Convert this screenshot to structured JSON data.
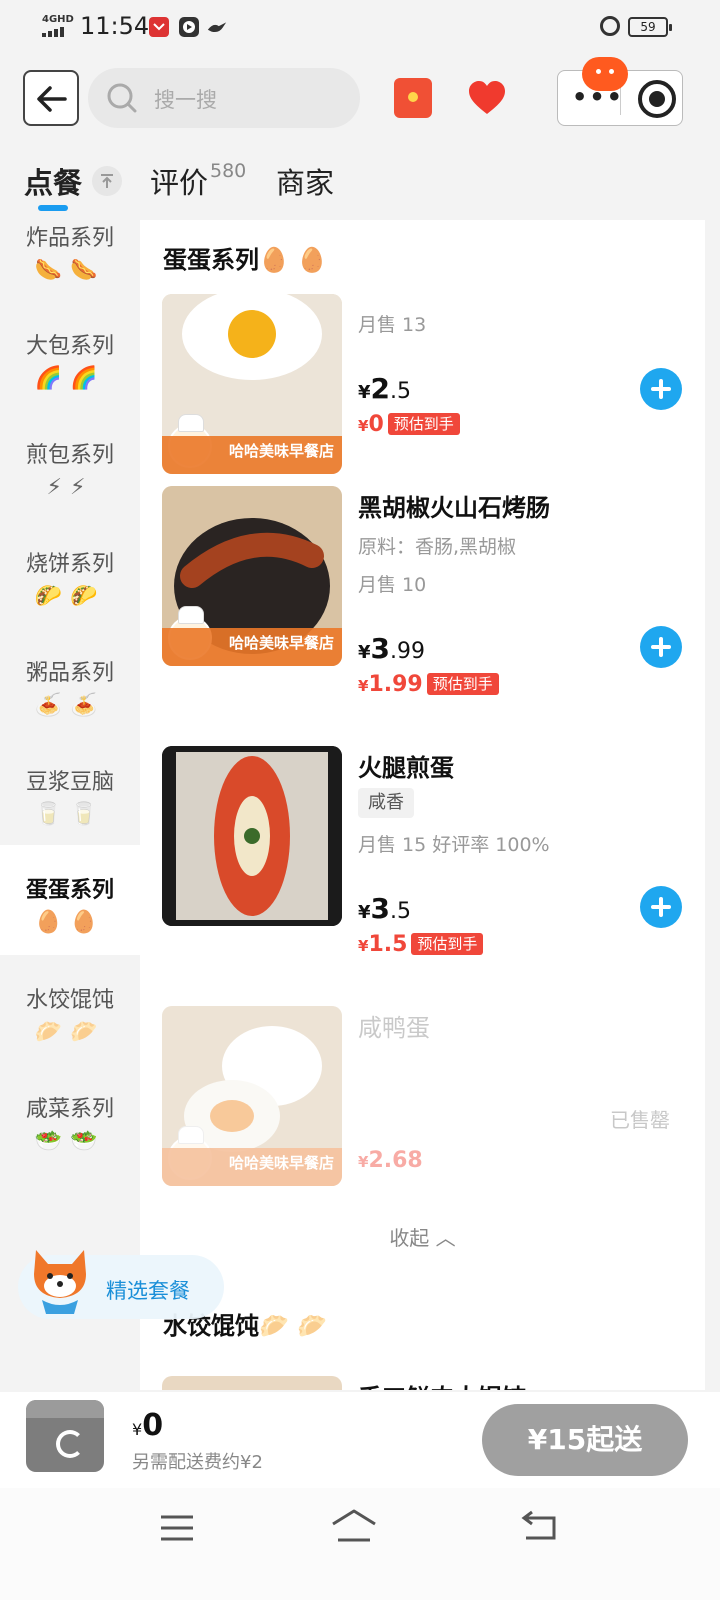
{
  "status_bar": {
    "network": "4GHD",
    "time": "11:54",
    "battery": "59"
  },
  "header": {
    "search_placeholder": "搜一搜"
  },
  "tabs": {
    "order": "点餐",
    "reviews": "评价",
    "reviews_count": "580",
    "shop": "商家"
  },
  "sidebar": {
    "items": [
      {
        "name": "炸品系列",
        "emoji": "🌭🌭"
      },
      {
        "name": "大包系列",
        "emoji": "🌈🌈"
      },
      {
        "name": "煎包系列",
        "emoji": "⚡⚡"
      },
      {
        "name": "烧饼系列",
        "emoji": "🌮🌮"
      },
      {
        "name": "粥品系列",
        "emoji": "🍝🍝"
      },
      {
        "name": "豆浆豆脑",
        "emoji": "🥛🥛"
      },
      {
        "name": "蛋蛋系列",
        "emoji": "🥚🥚"
      },
      {
        "name": "水饺馄饨",
        "emoji": "🥟🥟"
      },
      {
        "name": "咸菜系列",
        "emoji": "🥗🥗"
      }
    ]
  },
  "section": {
    "title": "蛋蛋系列🥚 🥚",
    "next_title": "水饺馄饨🥟 🥟"
  },
  "shop_stamp": "哈哈美味早餐店",
  "products": [
    {
      "name": "",
      "monthly_sales": "月售 13",
      "price_int": "2",
      "price_dec": ".5",
      "deal_price": "0",
      "deal_tag": "预估到手"
    },
    {
      "name": "黑胡椒火山石烤肠",
      "ingredients": "原料：香肠,黑胡椒",
      "monthly_sales": "月售 10",
      "price_int": "3",
      "price_dec": ".99",
      "deal_price": "1.99",
      "deal_tag": "预估到手"
    },
    {
      "name": "火腿煎蛋",
      "tag": "咸香",
      "monthly_sales": "月售 15 好评率 100%",
      "price_int": "3",
      "price_dec": ".5",
      "deal_price": "1.5",
      "deal_tag": "预估到手"
    },
    {
      "name": "咸鸭蛋",
      "sold_out": "已售罄",
      "price": "2.68"
    }
  ],
  "next_product_name": "手工鲜肉大馄饨",
  "collapse_label": "收起",
  "currency": "¥",
  "combo": {
    "label": "精选套餐"
  },
  "cart": {
    "amount": "0",
    "fee_note": "另需配送费约¥2",
    "min_order_label": "¥15起送"
  }
}
